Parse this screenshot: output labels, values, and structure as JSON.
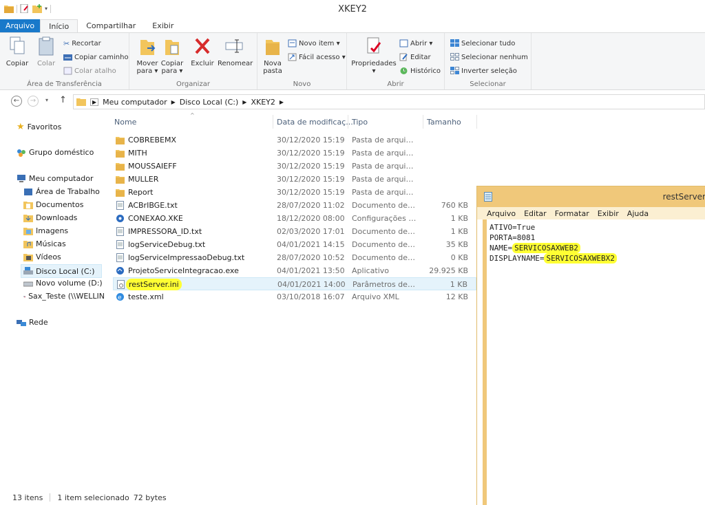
{
  "window": {
    "title": "XKEY2"
  },
  "tabs": [
    "Arquivo",
    "Início",
    "Compartilhar",
    "Exibir"
  ],
  "ribbon": {
    "clipboard": {
      "label": "Área de Transferência",
      "copy": "Copiar",
      "paste": "Colar",
      "cut": "Recortar",
      "copy_path": "Copiar caminho",
      "paste_shortcut": "Colar atalho"
    },
    "organize": {
      "label": "Organizar",
      "move_to": [
        "Mover",
        "para ▾"
      ],
      "copy_to": [
        "Copiar",
        "para ▾"
      ],
      "delete": "Excluir",
      "rename": "Renomear"
    },
    "new": {
      "label": "Novo",
      "new_folder": [
        "Nova",
        "pasta"
      ],
      "new_item": "Novo item ▾",
      "easy_access": "Fácil acesso ▾"
    },
    "open": {
      "label": "Abrir",
      "properties": "Propriedades",
      "open": "Abrir ▾",
      "edit": "Editar",
      "history": "Histórico"
    },
    "select": {
      "label": "Selecionar",
      "select_all": "Selecionar tudo",
      "select_none": "Selecionar nenhum",
      "invert": "Inverter seleção"
    }
  },
  "address": {
    "parts": [
      "Meu computador",
      "Disco Local (C:)",
      "XKEY2"
    ]
  },
  "sidebar": {
    "favorites": "Favoritos",
    "homegroup": "Grupo doméstico",
    "computer": "Meu computador",
    "items": [
      "Área de Trabalho",
      "Documentos",
      "Downloads",
      "Imagens",
      "Músicas",
      "Vídeos",
      "Disco Local (C:)",
      "Novo volume (D:)",
      "Sax_Teste (\\\\WELLIN"
    ],
    "network": "Rede"
  },
  "columns": {
    "name": "Nome",
    "date": "Data de modificaç...",
    "type": "Tipo",
    "size": "Tamanho"
  },
  "files": [
    {
      "name": "COBREBEMX",
      "date": "30/12/2020 15:19",
      "type": "Pasta de arquivos",
      "size": "",
      "icon": "folder"
    },
    {
      "name": "MITH",
      "date": "30/12/2020 15:19",
      "type": "Pasta de arquivos",
      "size": "",
      "icon": "folder"
    },
    {
      "name": "MOUSSAIEFF",
      "date": "30/12/2020 15:19",
      "type": "Pasta de arquivos",
      "size": "",
      "icon": "folder"
    },
    {
      "name": "MULLER",
      "date": "30/12/2020 15:19",
      "type": "Pasta de arquivos",
      "size": "",
      "icon": "folder"
    },
    {
      "name": "Report",
      "date": "30/12/2020 15:19",
      "type": "Pasta de arquivos",
      "size": "",
      "icon": "folder"
    },
    {
      "name": "ACBrIBGE.txt",
      "date": "28/07/2020 11:02",
      "type": "Documento de Te...",
      "size": "760 KB",
      "icon": "text"
    },
    {
      "name": "CONEXAO.XKE",
      "date": "18/12/2020 08:00",
      "type": "Configurações de ...",
      "size": "1 KB",
      "icon": "config"
    },
    {
      "name": "IMPRESSORA_ID.txt",
      "date": "02/03/2020 17:01",
      "type": "Documento de Te...",
      "size": "1 KB",
      "icon": "text"
    },
    {
      "name": "logServiceDebug.txt",
      "date": "04/01/2021 14:15",
      "type": "Documento de Te...",
      "size": "35 KB",
      "icon": "text"
    },
    {
      "name": "logServiceImpressaoDebug.txt",
      "date": "28/07/2020 10:52",
      "type": "Documento de Te...",
      "size": "0 KB",
      "icon": "text"
    },
    {
      "name": "ProjetoServiceIntegracao.exe",
      "date": "04/01/2021 13:50",
      "type": "Aplicativo",
      "size": "29.925 KB",
      "icon": "exe"
    },
    {
      "name": "restServer.ini",
      "date": "04/01/2021 14:00",
      "type": "Parâmetros de co...",
      "size": "1 KB",
      "icon": "ini"
    },
    {
      "name": "teste.xml",
      "date": "03/10/2018 16:07",
      "type": "Arquivo XML",
      "size": "12 KB",
      "icon": "xml"
    }
  ],
  "status": {
    "count": "13 itens",
    "selected": "1 item selecionado",
    "size": "72 bytes"
  },
  "notepad": {
    "title": "restServer",
    "menu": [
      "Arquivo",
      "Editar",
      "Formatar",
      "Exibir",
      "Ajuda"
    ],
    "lines": [
      {
        "key": "ATIVO=",
        "value": "True",
        "hl": false
      },
      {
        "key": "PORTA=",
        "value": "8081",
        "hl": false
      },
      {
        "key": "NAME=",
        "value": "SERVICOSAXWEB2",
        "hl": true
      },
      {
        "key": "DISPLAYNAME=",
        "value": "SERVICOSAXWEBX2",
        "hl": true
      }
    ]
  },
  "colors": {
    "accent": "#1979ca",
    "folder": "#f2c55c",
    "highlight": "#ffff33",
    "notepad_frame": "#f0c87a"
  }
}
